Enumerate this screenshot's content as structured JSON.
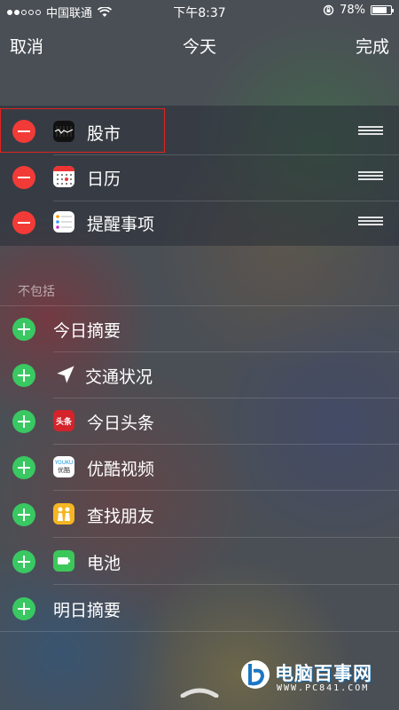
{
  "status_bar": {
    "carrier": "中国联通",
    "time": "下午8:37",
    "battery_percent": "78%",
    "battery_level": 0.78,
    "signal_dots_filled": 2,
    "signal_dots_total": 5
  },
  "nav": {
    "cancel_label": "取消",
    "title": "今天",
    "done_label": "完成"
  },
  "included_widgets": [
    {
      "label": "股市",
      "icon": "stocks-icon"
    },
    {
      "label": "日历",
      "icon": "calendar-icon"
    },
    {
      "label": "提醒事项",
      "icon": "reminders-icon"
    }
  ],
  "excluded_section": {
    "header": "不包括",
    "items": [
      {
        "label": "今日摘要",
        "icon": ""
      },
      {
        "label": "交通状况",
        "icon": "location-arrow-icon"
      },
      {
        "label": "今日头条",
        "icon": "toutiao-icon",
        "icon_text": "头条"
      },
      {
        "label": "优酷视频",
        "icon": "youku-icon",
        "icon_text": "优酷"
      },
      {
        "label": "查找朋友",
        "icon": "find-friends-icon"
      },
      {
        "label": "电池",
        "icon": "battery-app-icon"
      },
      {
        "label": "明日摘要",
        "icon": ""
      }
    ]
  },
  "watermark": {
    "brand": "电脑百事网",
    "url": "WWW.PC841.COM"
  },
  "colors": {
    "remove": "#f23b37",
    "add": "#39c862",
    "highlight_box": "#e0231f"
  }
}
